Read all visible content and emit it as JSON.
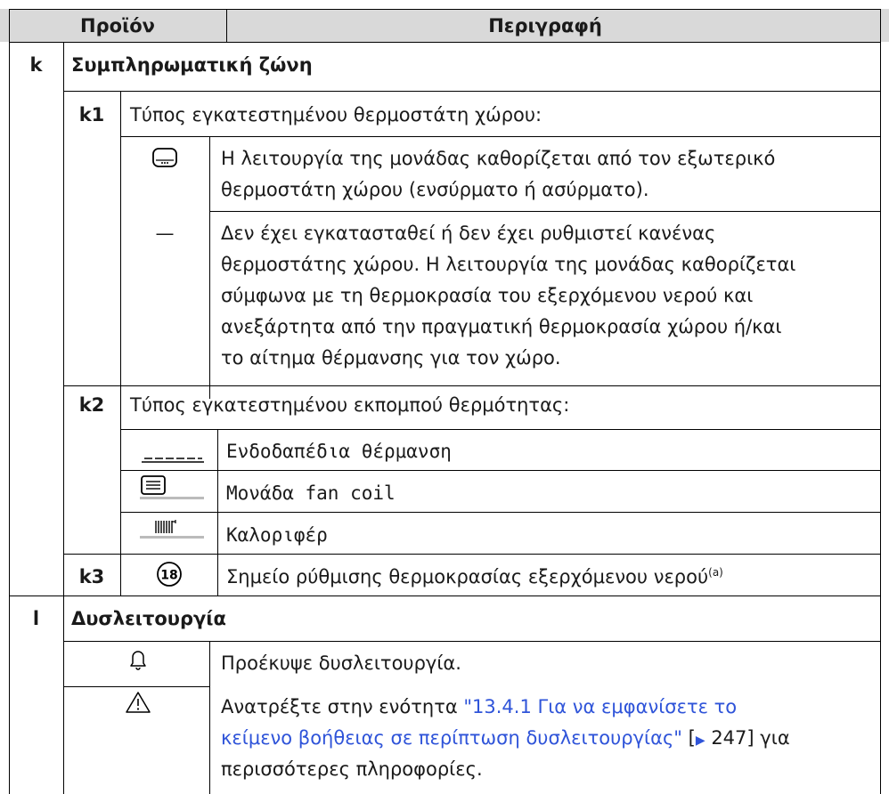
{
  "header": {
    "col_product": "Προϊόν",
    "col_description": "Περιγραφή"
  },
  "section_k": {
    "letter": "k",
    "title": "Συμπληρωματική ζώνη",
    "k1": {
      "code": "k1",
      "label": "Τύπος εγκατεστημένου θερμοστάτη χώρου:",
      "rows": [
        {
          "icon": "room-thermostat-icon",
          "text_lines": [
            "Η λειτουργία της μονάδας καθορίζεται από τον εξωτερικό",
            "θερμοστάτη χώρου (ενσύρματο ή ασύρματο)."
          ]
        },
        {
          "icon_text": "—",
          "text_lines": [
            "Δεν έχει εγκατασταθεί ή δεν έχει ρυθμιστεί κανένας",
            "θερμοστάτης χώρου. Η λειτουργία της μονάδας καθορίζεται",
            "σύμφωνα με τη θερμοκρασία του εξερχόμενου νερού και",
            "ανεξάρτητα από την πραγματική θερμοκρασία χώρου ή/και",
            "το αίτημα θέρμανσης για τον χώρο."
          ]
        }
      ]
    },
    "k2": {
      "code": "k2",
      "label": "Τύπος εγκατεστημένου εκπομπού θερμότητας:",
      "rows": [
        {
          "icon": "underfloor-heating-icon",
          "text": "Ενδοδαπέδια θέρμανση"
        },
        {
          "icon": "fan-coil-icon",
          "text": "Μονάδα fan coil"
        },
        {
          "icon": "radiator-icon",
          "text": "Καλοριφέρ"
        }
      ]
    },
    "k3": {
      "code": "k3",
      "icon_text": "18",
      "text": "Σημείο ρύθμισης θερμοκρασίας εξερχόμενου νερού",
      "superscript": "(a)"
    }
  },
  "section_l": {
    "letter": "l",
    "title": "Δυσλειτουργία",
    "row1": {
      "icon": "bell-icon",
      "text": "Προέκυψε δυσλειτουργία."
    },
    "row2": {
      "icon": "warning-triangle-icon",
      "line1_prefix": "Ανατρέξτε στην ενότητα ",
      "link_line1": "\"13.4.1 Για να εμφανίσετε το",
      "link_line2": "κείμενο βοήθειας σε περίπτωση δυσλειτουργίας\"",
      "page_ref": "247",
      "line2_suffix": " για",
      "line3": "περισσότερες πληροφορίες."
    }
  }
}
